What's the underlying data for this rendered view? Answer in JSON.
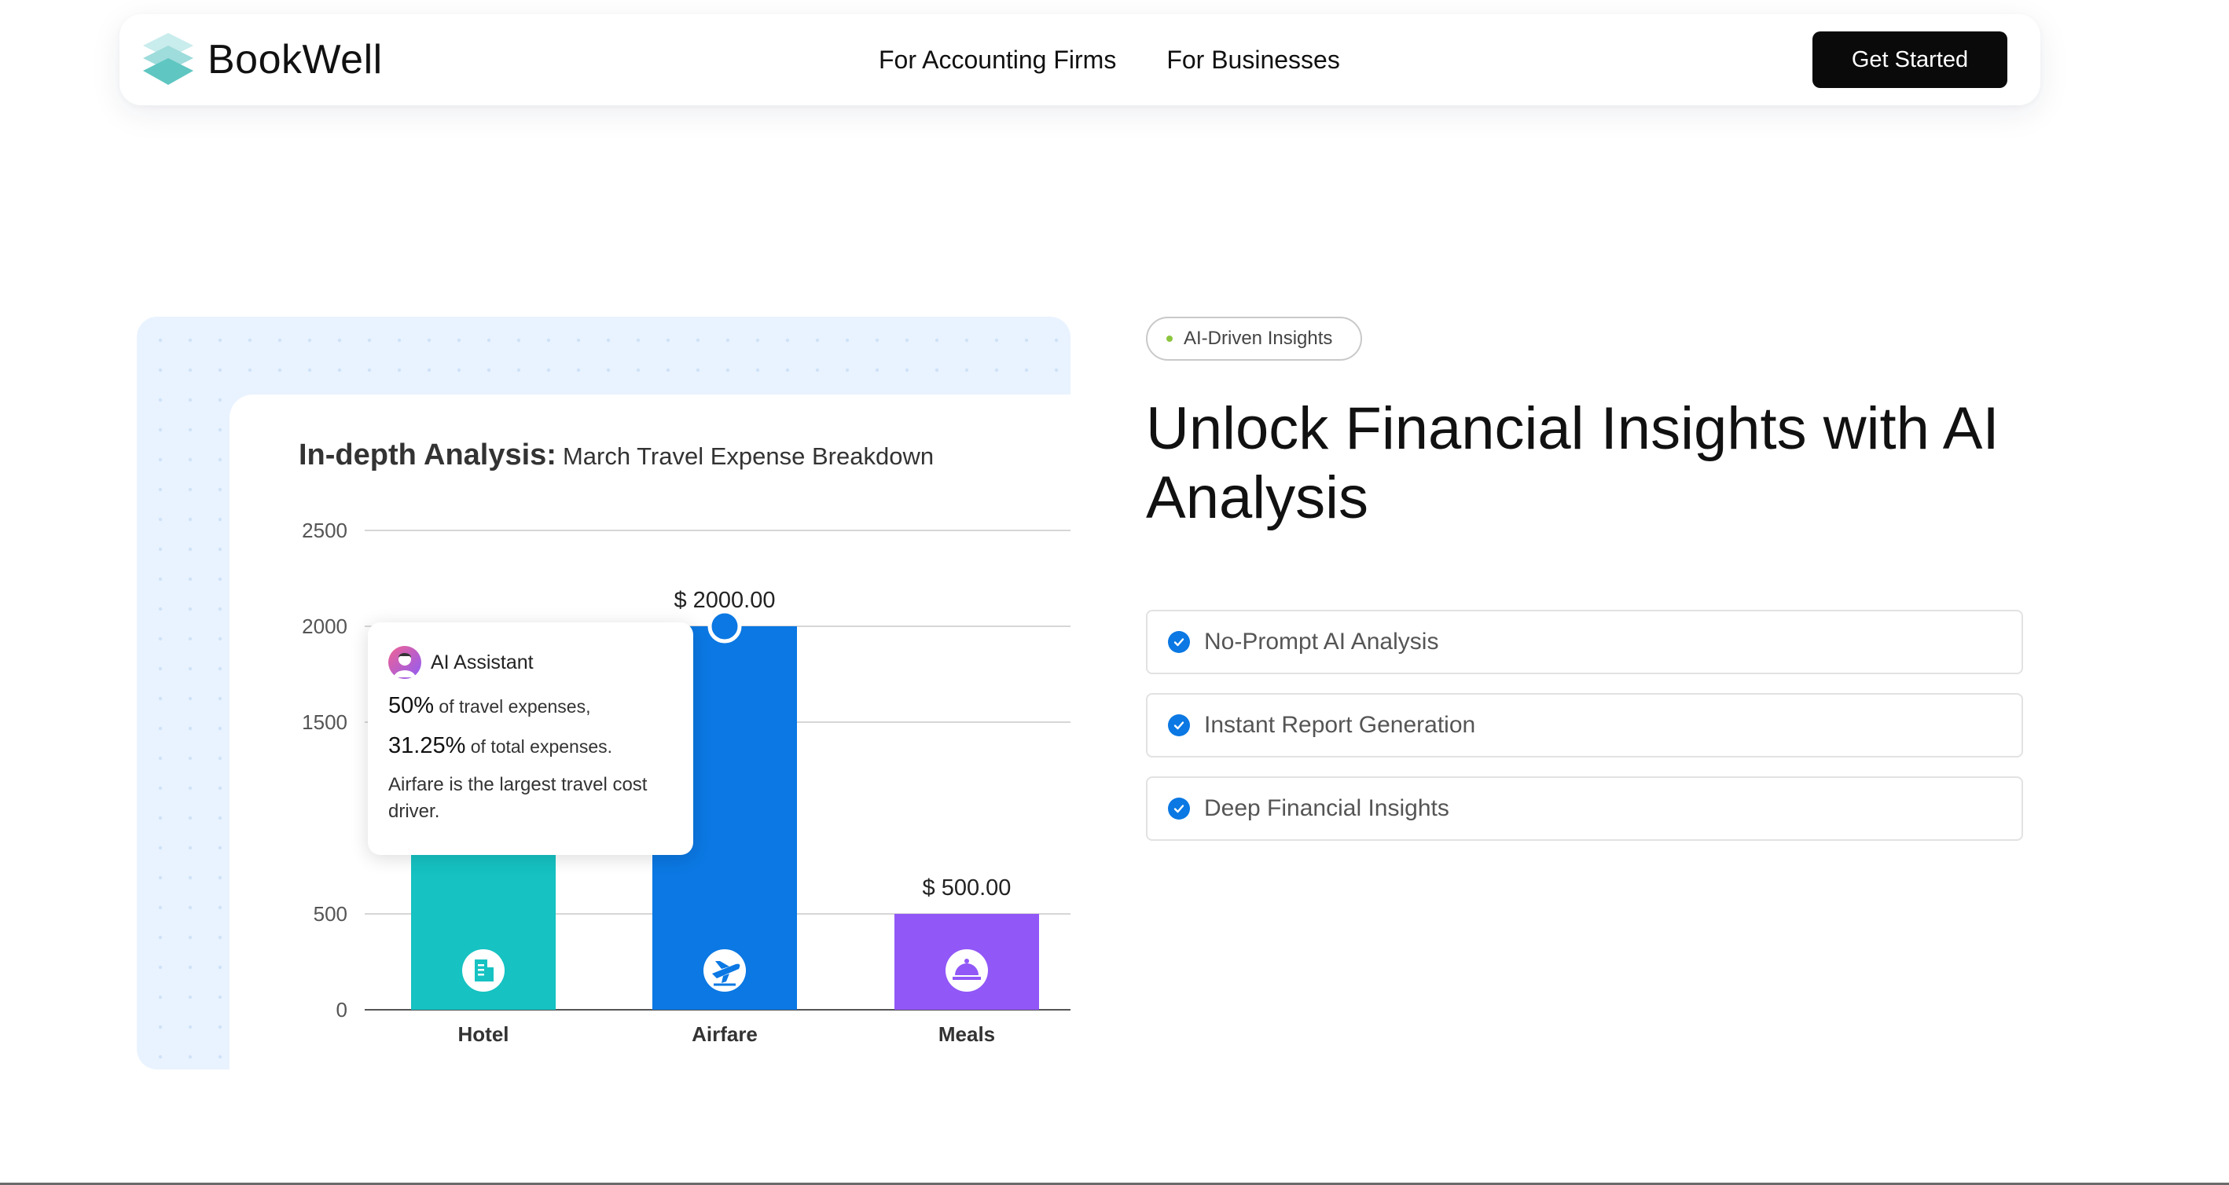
{
  "nav": {
    "brand": "BookWell",
    "links": [
      "For Accounting Firms",
      "For Businesses"
    ],
    "cta": "Get Started"
  },
  "card": {
    "title_strong": "In-depth Analysis:",
    "title_rest": "March Travel Expense Breakdown",
    "tooltip": {
      "name": "AI Assistant",
      "line1_pct": "50%",
      "line1_text": " of travel expenses,",
      "line2_pct": "31.25%",
      "line2_text": " of total expenses.",
      "note": "Airfare is the largest travel cost driver."
    }
  },
  "chart_data": {
    "type": "bar",
    "title": "In-depth Analysis: March Travel Expense Breakdown",
    "categories": [
      "Hotel",
      "Airfare",
      "Meals"
    ],
    "values": [
      1700,
      2000,
      500
    ],
    "value_labels": [
      "",
      "$ 2000.00",
      "$ 500.00"
    ],
    "colors": [
      "#16c2c2",
      "#0b78e3",
      "#9157f7"
    ],
    "icons": [
      "building-icon",
      "plane-icon",
      "cloche-icon"
    ],
    "yticks": [
      "0",
      "500",
      "1500",
      "2000",
      "2500"
    ],
    "ytick_values": [
      0,
      500,
      1500,
      2000,
      2500
    ],
    "ylim": [
      0,
      2500
    ],
    "grid": true
  },
  "right": {
    "badge": "AI-Driven Insights",
    "headline": "Unlock Financial Insights with AI Analysis",
    "features": [
      "No-Prompt AI Analysis",
      "Instant Report Generation",
      "Deep Financial Insights"
    ]
  }
}
